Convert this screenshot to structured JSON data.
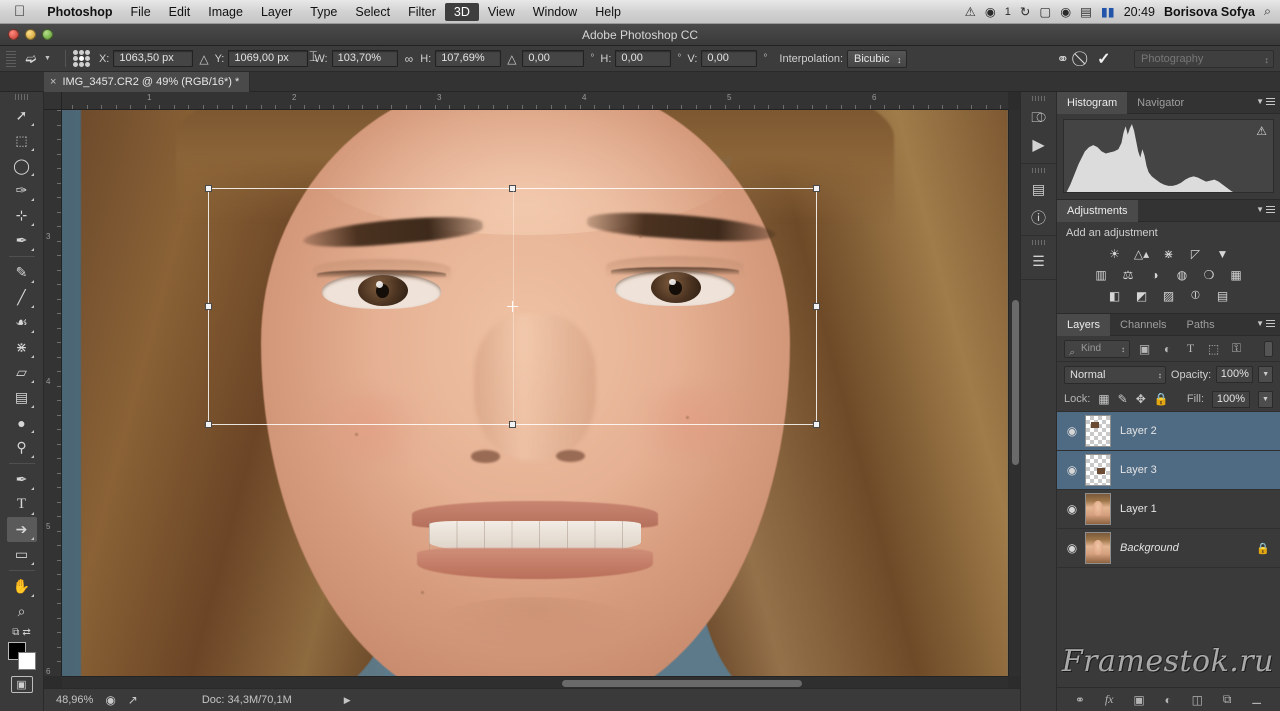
{
  "mac_menubar": {
    "apple_icon": "apple-logo",
    "items": [
      {
        "label": "Photoshop",
        "bold": true,
        "highlight": false
      },
      {
        "label": "File",
        "bold": false,
        "highlight": false
      },
      {
        "label": "Edit",
        "bold": false,
        "highlight": false
      },
      {
        "label": "Image",
        "bold": false,
        "highlight": false
      },
      {
        "label": "Layer",
        "bold": false,
        "highlight": false
      },
      {
        "label": "Type",
        "bold": false,
        "highlight": false
      },
      {
        "label": "Select",
        "bold": false,
        "highlight": false
      },
      {
        "label": "Filter",
        "bold": false,
        "highlight": false
      },
      {
        "label": "3D",
        "bold": false,
        "highlight": true
      },
      {
        "label": "View",
        "bold": false,
        "highlight": false
      },
      {
        "label": "Window",
        "bold": false,
        "highlight": false
      },
      {
        "label": "Help",
        "bold": false,
        "highlight": false
      }
    ],
    "status_icons": [
      {
        "name": "alert-icon",
        "glyph": "ⓘ"
      },
      {
        "name": "dropbox-icon",
        "glyph": "◉"
      },
      {
        "name": "time-machine-icon",
        "glyph": "↺"
      },
      {
        "name": "display-icon",
        "glyph": "▭"
      },
      {
        "name": "wifi-icon",
        "glyph": "◠"
      },
      {
        "name": "battery-icon",
        "glyph": "▆"
      },
      {
        "name": "flag-icon",
        "glyph": "⚑"
      }
    ],
    "dropbox_count": "1",
    "time": "20:49",
    "user": "Borisova Sofya",
    "search_icon": "⌕"
  },
  "titlebar": {
    "title": "Adobe Photoshop CC"
  },
  "options_bar": {
    "tool_preset_label": "move-transform-tool",
    "reference_point_label": "reference-point-locator",
    "x_label": "X:",
    "x_value": "1063,50 px",
    "delta_icon_1": "△",
    "y_label": "Y:",
    "y_value": "1069,00 px",
    "w_label": "W:",
    "w_value": "103,70%",
    "link_icon": "∞",
    "h_label": "H:",
    "h_value": "107,69%",
    "delta_icon_2": "△",
    "angle_value": "0,00",
    "degree_sign": "°",
    "skew_h_label": "H:",
    "skew_h_value": "0,00",
    "skew_v_label": "V:",
    "skew_v_value": "0,00",
    "interpolation_label": "Interpolation:",
    "interpolation_value": "Bicubic",
    "warp_icon": "warp-toggle-icon",
    "cancel_icon": "⃠",
    "commit_icon": "✓",
    "workspace": "Photography"
  },
  "tab_bar": {
    "close_glyph": "×",
    "document_title": "IMG_3457.CR2 @ 49% (RGB/16*) *"
  },
  "toolbar": {
    "tools": [
      {
        "name": "move-tool",
        "glyph": "✣",
        "selected": false
      },
      {
        "name": "rectangular-marquee-tool",
        "glyph": "⬚",
        "selected": false
      },
      {
        "name": "lasso-tool",
        "glyph": "○",
        "selected": false
      },
      {
        "name": "quick-selection-tool",
        "glyph": "✎",
        "selected": false
      },
      {
        "name": "crop-tool",
        "glyph": "⊹",
        "selected": false
      },
      {
        "name": "eyedropper-tool",
        "glyph": "✒",
        "selected": false
      },
      {
        "name": "spot-healing-brush-tool",
        "glyph": "✐",
        "selected": false
      },
      {
        "name": "brush-tool",
        "glyph": "∕",
        "selected": false
      },
      {
        "name": "clone-stamp-tool",
        "glyph": "⚑",
        "selected": false
      },
      {
        "name": "history-brush-tool",
        "glyph": "⌇",
        "selected": false
      },
      {
        "name": "eraser-tool",
        "glyph": "▱",
        "selected": false
      },
      {
        "name": "gradient-tool",
        "glyph": "▤",
        "selected": false
      },
      {
        "name": "blur-tool",
        "glyph": "●",
        "selected": false
      },
      {
        "name": "dodge-tool",
        "glyph": "⚲",
        "selected": false
      },
      {
        "name": "pen-tool",
        "glyph": "✒",
        "selected": false
      },
      {
        "name": "type-tool",
        "glyph": "T",
        "selected": false
      },
      {
        "name": "path-selection-tool",
        "glyph": "➤",
        "selected": true
      },
      {
        "name": "rectangle-shape-tool",
        "glyph": "▭",
        "selected": false
      },
      {
        "name": "hand-tool",
        "glyph": "✋",
        "selected": false
      },
      {
        "name": "zoom-tool",
        "glyph": "⌕",
        "selected": false
      }
    ],
    "swap_icon": "⇄",
    "default_colors_icon": "⧉",
    "foreground_color": "#000000",
    "background_color": "#ffffff",
    "quick_mask_icon": "▣"
  },
  "rulers": {
    "horizontal_ticks": [
      "1",
      "2",
      "3",
      "4",
      "5",
      "6"
    ],
    "vertical_ticks": [
      "3",
      "4",
      "5",
      "6"
    ],
    "unit": "inches"
  },
  "status_bar": {
    "zoom": "48,96%",
    "icons": [
      {
        "name": "preview-flyout-icon",
        "glyph": "◎"
      },
      {
        "name": "share-icon",
        "glyph": "↗"
      }
    ],
    "doc_info": "Doc: 34,3M/70,1M",
    "arrow": "▶"
  },
  "panel_dock": {
    "buttons": [
      {
        "name": "history-panel-icon",
        "glyph": "⎌"
      },
      {
        "name": "actions-play-icon",
        "glyph": "▶"
      },
      {
        "name": "properties-panel-icon",
        "glyph": "▤"
      },
      {
        "name": "info-panel-icon",
        "glyph": "ℹ"
      },
      {
        "name": "layer-comps-icon",
        "glyph": "≣"
      }
    ]
  },
  "histogram_panel": {
    "tabs": [
      {
        "label": "Histogram",
        "active": true
      },
      {
        "label": "Navigator",
        "active": false
      }
    ],
    "warning_icon": "⚠",
    "menu_icon": "panel-menu-icon"
  },
  "adjustments_panel": {
    "tab_label": "Adjustments",
    "heading": "Add an adjustment",
    "rows": [
      [
        {
          "name": "brightness-contrast-icon",
          "glyph": "☀"
        },
        {
          "name": "levels-icon",
          "glyph": "☳"
        },
        {
          "name": "curves-icon",
          "glyph": "⌇"
        },
        {
          "name": "exposure-icon",
          "glyph": "◨"
        },
        {
          "name": "vibrance-icon",
          "glyph": "▽"
        }
      ],
      [
        {
          "name": "hue-saturation-icon",
          "glyph": "▥"
        },
        {
          "name": "color-balance-icon",
          "glyph": "⚖"
        },
        {
          "name": "black-white-icon",
          "glyph": "◑"
        },
        {
          "name": "photo-filter-icon",
          "glyph": "◍"
        },
        {
          "name": "channel-mixer-icon",
          "glyph": "○"
        },
        {
          "name": "color-lookup-icon",
          "glyph": "▦"
        }
      ],
      [
        {
          "name": "invert-icon",
          "glyph": "◧"
        },
        {
          "name": "posterize-icon",
          "glyph": "◩"
        },
        {
          "name": "threshold-icon",
          "glyph": "▨"
        },
        {
          "name": "selective-color-icon",
          "glyph": "⧖"
        },
        {
          "name": "gradient-map-icon",
          "glyph": "▤"
        }
      ]
    ]
  },
  "layers_panel": {
    "tabs": [
      {
        "label": "Layers",
        "active": true
      },
      {
        "label": "Channels",
        "active": false
      },
      {
        "label": "Paths",
        "active": false
      }
    ],
    "filter": {
      "kind_label": "Kind",
      "search_icon": "⌕",
      "icons": [
        {
          "name": "filter-pixel-icon",
          "glyph": "▣"
        },
        {
          "name": "filter-adjustment-icon",
          "glyph": "◐"
        },
        {
          "name": "filter-type-icon",
          "glyph": "T"
        },
        {
          "name": "filter-shape-icon",
          "glyph": "⬚"
        },
        {
          "name": "filter-smart-object-icon",
          "glyph": "⚿"
        }
      ]
    },
    "blend_mode": "Normal",
    "opacity_label": "Opacity:",
    "opacity_value": "100%",
    "lock_label": "Lock:",
    "lock_icons": [
      {
        "name": "lock-transparent-pixels-icon",
        "glyph": "▦"
      },
      {
        "name": "lock-image-pixels-icon",
        "glyph": "✐"
      },
      {
        "name": "lock-position-icon",
        "glyph": "✥"
      },
      {
        "name": "lock-all-icon",
        "glyph": "🔒"
      }
    ],
    "fill_label": "Fill:",
    "fill_value": "100%",
    "layers": [
      {
        "name": "Layer 2",
        "selected": true,
        "thumb": "checker",
        "locked": false,
        "italic": false
      },
      {
        "name": "Layer 3",
        "selected": true,
        "thumb": "checker",
        "locked": false,
        "italic": false
      },
      {
        "name": "Layer 1",
        "selected": false,
        "thumb": "photo",
        "locked": false,
        "italic": false
      },
      {
        "name": "Background",
        "selected": false,
        "thumb": "photo",
        "locked": true,
        "italic": true
      }
    ],
    "eye_glyph": "◉",
    "lock_badge_glyph": "🔒",
    "footer_icons": [
      {
        "name": "link-layers-icon",
        "glyph": "⚭"
      },
      {
        "name": "layer-style-fx-icon",
        "glyph": "fx"
      },
      {
        "name": "add-layer-mask-icon",
        "glyph": "▣"
      },
      {
        "name": "new-fill-adjustment-icon",
        "glyph": "◐"
      },
      {
        "name": "new-group-icon",
        "glyph": "▰"
      },
      {
        "name": "new-layer-icon",
        "glyph": "⧉"
      },
      {
        "name": "delete-layer-icon",
        "glyph": "🗑"
      }
    ]
  },
  "watermark": {
    "text": "Framestok.ru"
  },
  "colors": {
    "panel_bg": "#3a3a3a",
    "selection_blue": "#4f6a83",
    "canvas_bg": "#2c2c2c",
    "menubar_bg": "#d2d2d2"
  }
}
